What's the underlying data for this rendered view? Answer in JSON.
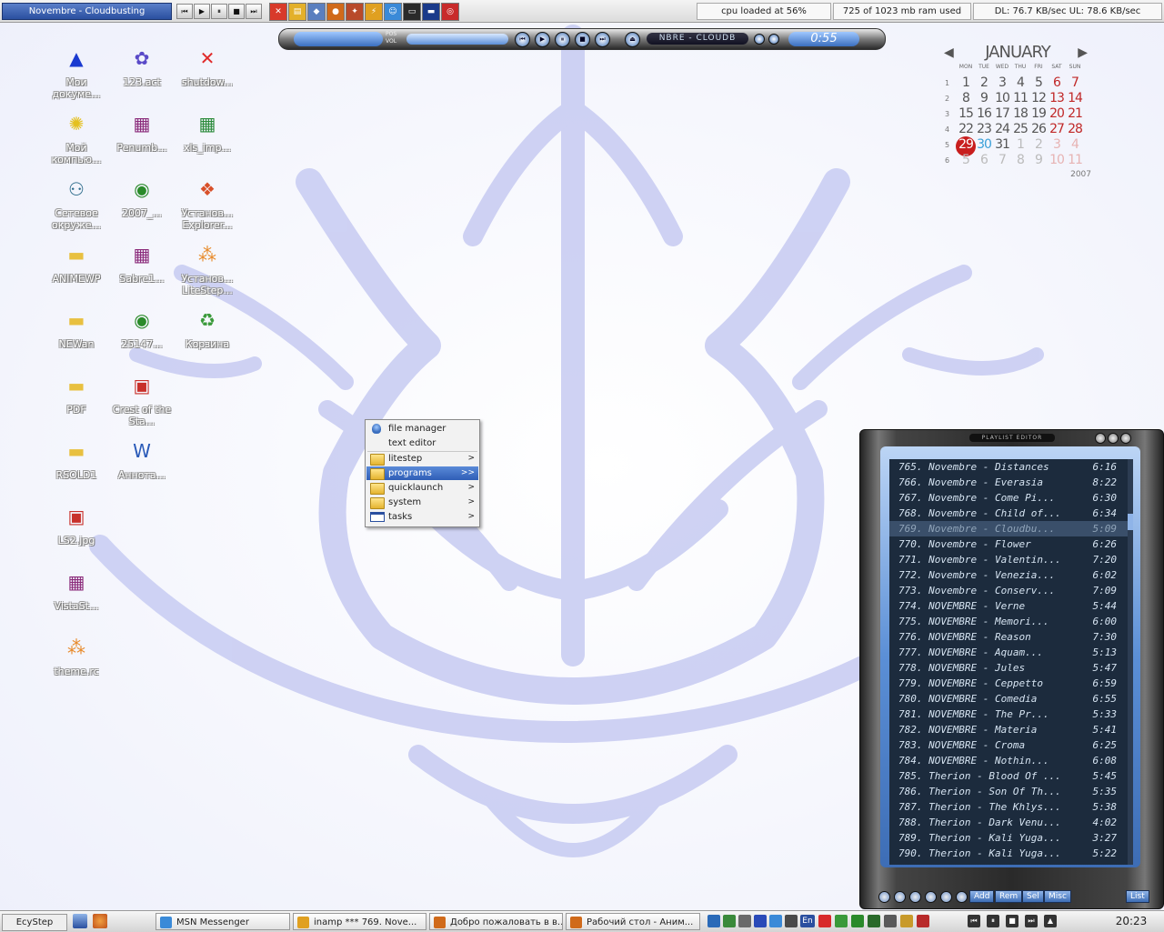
{
  "topbar": {
    "title": "Novembre - Cloudbusting",
    "media_buttons": [
      "⏮",
      "▶",
      "⏸",
      "■",
      "⏭"
    ],
    "quicklaunch": [
      {
        "icon": "close-icon",
        "color": "#d83a2a",
        "glyph": "✕"
      },
      {
        "icon": "folder-icon",
        "color": "#e3b02a",
        "glyph": "▤"
      },
      {
        "icon": "network-icon",
        "color": "#5a7fbf",
        "glyph": "◆"
      },
      {
        "icon": "firefox-icon",
        "color": "#d06a1a",
        "glyph": "●"
      },
      {
        "icon": "game-icon",
        "color": "#b84a2a",
        "glyph": "✦"
      },
      {
        "icon": "winamp-icon",
        "color": "#e0a020",
        "glyph": "⚡"
      },
      {
        "icon": "messenger-icon",
        "color": "#3a8ad8",
        "glyph": "☺"
      },
      {
        "icon": "monitor-icon",
        "color": "#2a2a2a",
        "glyph": "▭"
      },
      {
        "icon": "terminal-icon",
        "color": "#1a3a8a",
        "glyph": "▬"
      },
      {
        "icon": "opera-icon",
        "color": "#c82a2a",
        "glyph": "◎"
      }
    ],
    "cpu": "cpu loaded at 56%",
    "ram": "725 of 1023 mb ram used",
    "net": "DL: 76.7 KB/sec UL: 78.6 KB/sec"
  },
  "winamp": {
    "pos_label": "POS",
    "vol_label": "VOL",
    "scroller": "NBRE - CLOUDB",
    "time": "0:55",
    "buttons": [
      "⏮",
      "▶",
      "⏸",
      "■",
      "⏭",
      "⏏"
    ]
  },
  "calendar": {
    "month": "JANUARY",
    "year": "2007",
    "weekdays": [
      "MON",
      "TUE",
      "WED",
      "THU",
      "FRI",
      "SAT",
      "SUN"
    ],
    "weeks": [
      "1",
      "2",
      "3",
      "4",
      "5",
      "6"
    ],
    "days": [
      [
        "1",
        "2",
        "3",
        "4",
        "5",
        "6",
        "7"
      ],
      [
        "8",
        "9",
        "10",
        "11",
        "12",
        "13",
        "14"
      ],
      [
        "15",
        "16",
        "17",
        "18",
        "19",
        "20",
        "21"
      ],
      [
        "22",
        "23",
        "24",
        "25",
        "26",
        "27",
        "28"
      ],
      [
        "29",
        "30",
        "31",
        "1",
        "2",
        "3",
        "4"
      ],
      [
        "5",
        "6",
        "7",
        "8",
        "9",
        "10",
        "11"
      ]
    ],
    "today_row": 4,
    "today_col": 0,
    "selected_row": 4,
    "selected_col": 1,
    "today_ring_color": "#c81e1e"
  },
  "desktop_icons": [
    {
      "label": "Мои докуме...",
      "icon": "my-documents-icon",
      "glyph": "▲",
      "color": "#1a3ad0"
    },
    {
      "label": "123.act",
      "icon": "clut-icon",
      "glyph": "✿",
      "color": "#5a4ac8"
    },
    {
      "label": "shutdow...",
      "icon": "shutdown-icon",
      "glyph": "✕",
      "color": "#e02a2a"
    },
    {
      "label": "Мой компью...",
      "icon": "my-computer-icon",
      "glyph": "✺",
      "color": "#e4c020"
    },
    {
      "label": "Penumb...",
      "icon": "archive-icon",
      "glyph": "▦",
      "color": "#8a2a7a"
    },
    {
      "label": "Сетевое окруже...",
      "icon": "network-places-icon",
      "glyph": "⚇",
      "color": "#2a6a8a"
    },
    {
      "label": "2007_...",
      "icon": "gif-eye-icon",
      "glyph": "◉",
      "color": "#2a8a2a"
    },
    {
      "label": "xls_imp...",
      "icon": "excel-icon",
      "glyph": "▦",
      "color": "#2a8a3a"
    },
    {
      "label": "ANIMEWP",
      "icon": "folder-icon",
      "glyph": "▬",
      "color": "#e8c040"
    },
    {
      "label": "Sabre1...",
      "icon": "archive-icon",
      "glyph": "▦",
      "color": "#8a2a7a"
    },
    {
      "label": "Установ... Explorer...",
      "icon": "windows-installer-icon",
      "glyph": "❖",
      "color": "#d8502a"
    },
    {
      "label": "NEWan",
      "icon": "folder-icon",
      "glyph": "▬",
      "color": "#e8c040"
    },
    {
      "label": "25147...",
      "icon": "gif-eye-icon",
      "glyph": "◉",
      "color": "#2a8a2a"
    },
    {
      "label": "Установ... LiteStep...",
      "icon": "litestep-installer-icon",
      "glyph": "⁂",
      "color": "#e88a2a"
    },
    {
      "label": "PDF",
      "icon": "folder-icon",
      "glyph": "▬",
      "color": "#e8c040"
    },
    {
      "label": "Crest of the Sta...",
      "icon": "image-file-icon",
      "glyph": "▣",
      "color": "#c8302a"
    },
    {
      "label": "Корзина",
      "icon": "recycle-bin-icon",
      "glyph": "♻",
      "color": "#3a9a3a"
    },
    {
      "label": "RSOLD1",
      "icon": "folder-icon",
      "glyph": "▬",
      "color": "#e8c040"
    },
    {
      "label": "Аннота...",
      "icon": "word-doc-icon",
      "glyph": "W",
      "color": "#2a5ab8"
    },
    {
      "label": "LS2.jpg",
      "icon": "jpg-file-icon",
      "glyph": "▣",
      "color": "#c8302a"
    },
    {
      "label": "VistaSt...",
      "icon": "archive-icon",
      "glyph": "▦",
      "color": "#8a2a7a"
    },
    {
      "label": "theme.rc",
      "icon": "rc-file-icon",
      "glyph": "⁂",
      "color": "#e88a2a"
    }
  ],
  "menu": {
    "items": [
      {
        "label": "file manager",
        "icon": "file-manager-icon",
        "submenu": ""
      },
      {
        "label": "text editor",
        "icon": "",
        "submenu": ""
      },
      {
        "label": "litestep",
        "icon": "folder-icon",
        "submenu": ">"
      },
      {
        "label": "programs",
        "icon": "folder-icon",
        "submenu": ">>"
      },
      {
        "label": "quicklaunch",
        "icon": "folder-icon",
        "submenu": ">"
      },
      {
        "label": "system",
        "icon": "folder-icon",
        "submenu": ">"
      },
      {
        "label": "tasks",
        "icon": "window-icon",
        "submenu": ">"
      }
    ]
  },
  "playlist": {
    "title": "PLAYLIST EDITOR",
    "rows": [
      {
        "title": "765. Novembre - Distances",
        "dur": "6:16"
      },
      {
        "title": "766. Novembre - Everasia",
        "dur": "8:22"
      },
      {
        "title": "767. Novembre - Come Pi...",
        "dur": "6:30"
      },
      {
        "title": "768. Novembre - Child of...",
        "dur": "6:34"
      },
      {
        "title": "769. Novembre - Cloudbu...",
        "dur": "5:09"
      },
      {
        "title": "770. Novembre - Flower",
        "dur": "6:26"
      },
      {
        "title": "771. Novembre - Valentin...",
        "dur": "7:20"
      },
      {
        "title": "772. Novembre - Venezia...",
        "dur": "6:02"
      },
      {
        "title": "773. Novembre - Conserv...",
        "dur": "7:09"
      },
      {
        "title": "774. NOVEMBRE - Verne",
        "dur": "5:44"
      },
      {
        "title": "775. NOVEMBRE - Memori...",
        "dur": "6:00"
      },
      {
        "title": "776. NOVEMBRE - Reason",
        "dur": "7:30"
      },
      {
        "title": "777. NOVEMBRE - Aquam...",
        "dur": "5:13"
      },
      {
        "title": "778. NOVEMBRE - Jules",
        "dur": "5:47"
      },
      {
        "title": "779. NOVEMBRE - Ceppetto",
        "dur": "6:59"
      },
      {
        "title": "780. NOVEMBRE - Comedia",
        "dur": "6:55"
      },
      {
        "title": "781. NOVEMBRE - The Pr...",
        "dur": "5:33"
      },
      {
        "title": "782. NOVEMBRE - Materia",
        "dur": "5:41"
      },
      {
        "title": "783. NOVEMBRE - Croma",
        "dur": "6:25"
      },
      {
        "title": "784. NOVEMBRE - Nothin...",
        "dur": "6:08"
      },
      {
        "title": "785. Therion - Blood Of ...",
        "dur": "5:45"
      },
      {
        "title": "786. Therion - Son Of Th...",
        "dur": "5:35"
      },
      {
        "title": "787. Therion - The Khlys...",
        "dur": "5:38"
      },
      {
        "title": "788. Therion - Dark Venu...",
        "dur": "4:02"
      },
      {
        "title": "789. Therion - Kali Yuga...",
        "dur": "3:27"
      },
      {
        "title": "790. Therion - Kali Yuga...",
        "dur": "5:22"
      }
    ],
    "current_index": 4,
    "buttons": {
      "add": "Add",
      "rem": "Rem",
      "sel": "Sel",
      "misc": "Misc",
      "list": "List"
    }
  },
  "taskbar": {
    "start_label": "EcyStep",
    "tasks": [
      {
        "label": "MSN Messenger",
        "icon": "msn-icon",
        "color": "#3a8ad8"
      },
      {
        "label": "inamp *** 769. Nove...",
        "icon": "winamp-icon",
        "color": "#e0a020"
      },
      {
        "label": "Добро пожаловать в в...",
        "icon": "firefox-icon",
        "color": "#d06a1a"
      },
      {
        "label": "Рабочий стол - Аним...",
        "icon": "firefox-icon",
        "color": "#d06a1a"
      }
    ],
    "lang": "En",
    "clock": "20:23",
    "tray": [
      {
        "icon": "keyboard-icon",
        "color": "#2a6ab8"
      },
      {
        "icon": "network-tray-icon",
        "color": "#3a8a3a"
      },
      {
        "icon": "cd-icon",
        "color": "#6a6a6a"
      },
      {
        "icon": "shield-icon",
        "color": "#2a4ab8"
      },
      {
        "icon": "messenger-tray-icon",
        "color": "#3a8ad8"
      },
      {
        "icon": "volume-icon",
        "color": "#4a4a4a"
      },
      {
        "icon": "update-icon",
        "color": "#d82a2a"
      },
      {
        "icon": "download-icon",
        "color": "#3a9a3a"
      },
      {
        "icon": "eye-icon",
        "color": "#2a8a2a"
      },
      {
        "icon": "antivirus-icon",
        "color": "#2a6a2a"
      },
      {
        "icon": "gear-icon",
        "color": "#5a5a5a"
      },
      {
        "icon": "folder-tray-icon",
        "color": "#c89a2a"
      },
      {
        "icon": "flag-icon",
        "color": "#b82a2a"
      }
    ],
    "media": [
      "⏮",
      "⏸",
      "■",
      "⏭",
      "▲"
    ]
  }
}
